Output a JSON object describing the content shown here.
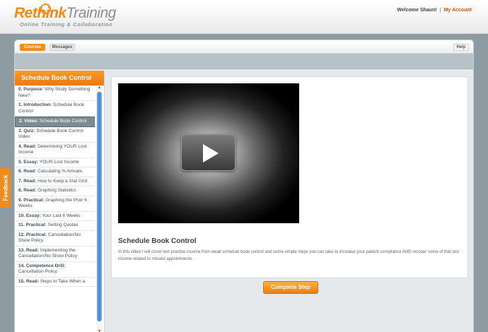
{
  "header": {
    "logo_rethink": "Rethink",
    "logo_training": "Training",
    "logo_tagline": "Online Training & Collaboration",
    "welcome": "Welcome Shaun!",
    "separator": "|",
    "my_account": "My Account"
  },
  "tabs": {
    "courses": "Courses",
    "messages": "Messages",
    "help": "Help"
  },
  "sidebar": {
    "title": "Schedule Book Control",
    "items": [
      {
        "prefix": "0. Purpose:",
        "text": "Why Study Something New?"
      },
      {
        "prefix": "1. Introduction:",
        "text": "Schedule Book Control"
      },
      {
        "prefix": "2. Video:",
        "text": "Schedule Book Control"
      },
      {
        "prefix": "3. Quiz:",
        "text": "Schedule Book Control Video"
      },
      {
        "prefix": "4. Read:",
        "text": "Determining YOUR Lost Income"
      },
      {
        "prefix": "5. Essay:",
        "text": "YOUR Lost Income"
      },
      {
        "prefix": "6. Read:",
        "text": "Calculating % Arrivals"
      },
      {
        "prefix": "7. Read:",
        "text": "How to Keep a Stat Grid"
      },
      {
        "prefix": "8. Read:",
        "text": "Graphing Statistics"
      },
      {
        "prefix": "9. Practical:",
        "text": "Graphing the Prior 6 Weeks"
      },
      {
        "prefix": "10. Essay:",
        "text": "Your Last 6 Weeks"
      },
      {
        "prefix": "11. Practical:",
        "text": "Setting Quotas"
      },
      {
        "prefix": "12. Practical:",
        "text": "Cancellation/No Show Policy"
      },
      {
        "prefix": "13. Read:",
        "text": "Implementing the Cancellation/No Show Policy"
      },
      {
        "prefix": "14. Competence Drill:",
        "text": "Cancellation Policy"
      },
      {
        "prefix": "15. Read:",
        "text": "Steps to Take When a"
      }
    ],
    "active_index": 2
  },
  "content": {
    "title": "Schedule Book Control",
    "description": "In this video I will cover lost practice income from weak schedule book control and some simple steps you can take to increase your patient compliance AND recover some of that lost income related to missed appointments."
  },
  "complete_button": "Complete Step",
  "feedback_tab": "Feedback",
  "colors": {
    "accent": "#f18b1b",
    "active_item": "#7f8b93",
    "scrollbar": "#3b84d3"
  }
}
